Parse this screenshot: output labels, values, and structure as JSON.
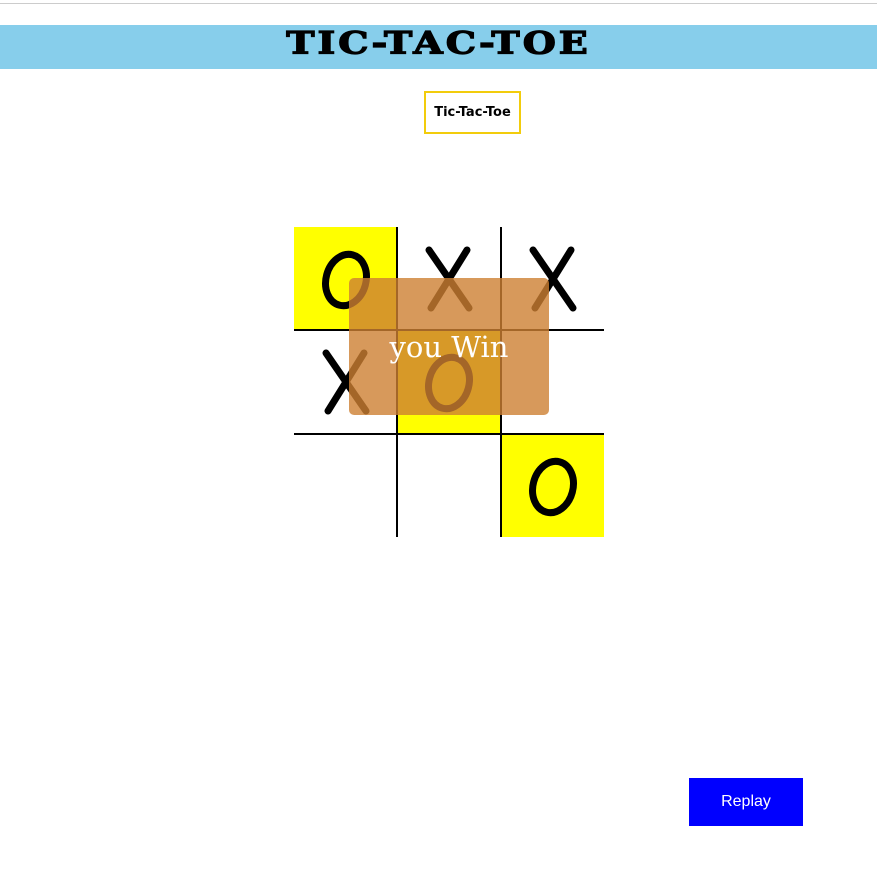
{
  "header": {
    "title": "Tic-Tac-Toe"
  },
  "subtitle": {
    "label": "Tic-Tac-Toe"
  },
  "board": {
    "cells": [
      "O",
      "X",
      "X",
      "X",
      "O",
      "",
      "",
      "",
      "O"
    ],
    "winning_cells": [
      0,
      4,
      8
    ],
    "highlight_color": "#ffff00"
  },
  "result": {
    "message": "you Win"
  },
  "controls": {
    "replay_label": "Replay"
  },
  "colors": {
    "banner": "#87ceeb",
    "subtitle_border": "#f2cc0c",
    "overlay": "#cd7f32",
    "replay_button": "#0000ff"
  }
}
